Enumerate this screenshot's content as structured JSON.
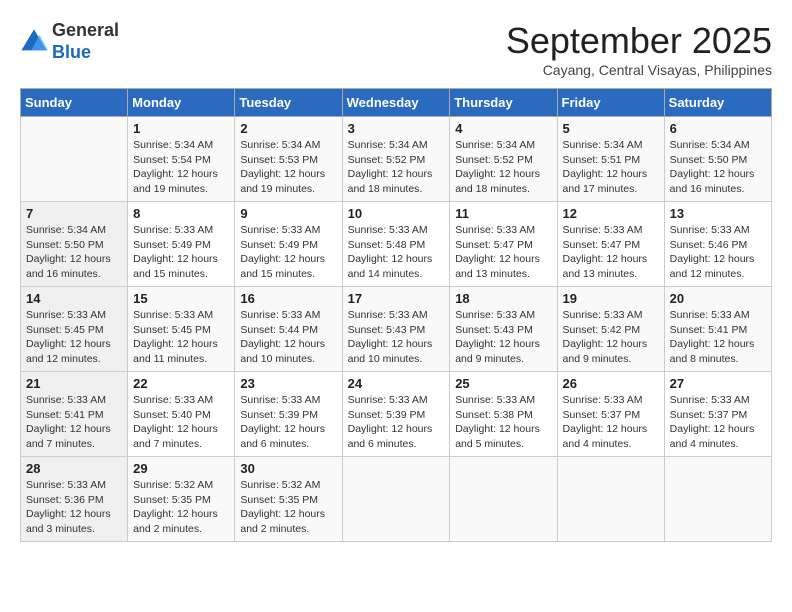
{
  "header": {
    "logo_line1": "General",
    "logo_line2": "Blue",
    "month": "September 2025",
    "location": "Cayang, Central Visayas, Philippines"
  },
  "days_of_week": [
    "Sunday",
    "Monday",
    "Tuesday",
    "Wednesday",
    "Thursday",
    "Friday",
    "Saturday"
  ],
  "weeks": [
    [
      {
        "day": "",
        "info": ""
      },
      {
        "day": "1",
        "info": "Sunrise: 5:34 AM\nSunset: 5:54 PM\nDaylight: 12 hours\nand 19 minutes."
      },
      {
        "day": "2",
        "info": "Sunrise: 5:34 AM\nSunset: 5:53 PM\nDaylight: 12 hours\nand 19 minutes."
      },
      {
        "day": "3",
        "info": "Sunrise: 5:34 AM\nSunset: 5:52 PM\nDaylight: 12 hours\nand 18 minutes."
      },
      {
        "day": "4",
        "info": "Sunrise: 5:34 AM\nSunset: 5:52 PM\nDaylight: 12 hours\nand 18 minutes."
      },
      {
        "day": "5",
        "info": "Sunrise: 5:34 AM\nSunset: 5:51 PM\nDaylight: 12 hours\nand 17 minutes."
      },
      {
        "day": "6",
        "info": "Sunrise: 5:34 AM\nSunset: 5:50 PM\nDaylight: 12 hours\nand 16 minutes."
      }
    ],
    [
      {
        "day": "7",
        "info": "Sunrise: 5:34 AM\nSunset: 5:50 PM\nDaylight: 12 hours\nand 16 minutes."
      },
      {
        "day": "8",
        "info": "Sunrise: 5:33 AM\nSunset: 5:49 PM\nDaylight: 12 hours\nand 15 minutes."
      },
      {
        "day": "9",
        "info": "Sunrise: 5:33 AM\nSunset: 5:49 PM\nDaylight: 12 hours\nand 15 minutes."
      },
      {
        "day": "10",
        "info": "Sunrise: 5:33 AM\nSunset: 5:48 PM\nDaylight: 12 hours\nand 14 minutes."
      },
      {
        "day": "11",
        "info": "Sunrise: 5:33 AM\nSunset: 5:47 PM\nDaylight: 12 hours\nand 13 minutes."
      },
      {
        "day": "12",
        "info": "Sunrise: 5:33 AM\nSunset: 5:47 PM\nDaylight: 12 hours\nand 13 minutes."
      },
      {
        "day": "13",
        "info": "Sunrise: 5:33 AM\nSunset: 5:46 PM\nDaylight: 12 hours\nand 12 minutes."
      }
    ],
    [
      {
        "day": "14",
        "info": "Sunrise: 5:33 AM\nSunset: 5:45 PM\nDaylight: 12 hours\nand 12 minutes."
      },
      {
        "day": "15",
        "info": "Sunrise: 5:33 AM\nSunset: 5:45 PM\nDaylight: 12 hours\nand 11 minutes."
      },
      {
        "day": "16",
        "info": "Sunrise: 5:33 AM\nSunset: 5:44 PM\nDaylight: 12 hours\nand 10 minutes."
      },
      {
        "day": "17",
        "info": "Sunrise: 5:33 AM\nSunset: 5:43 PM\nDaylight: 12 hours\nand 10 minutes."
      },
      {
        "day": "18",
        "info": "Sunrise: 5:33 AM\nSunset: 5:43 PM\nDaylight: 12 hours\nand 9 minutes."
      },
      {
        "day": "19",
        "info": "Sunrise: 5:33 AM\nSunset: 5:42 PM\nDaylight: 12 hours\nand 9 minutes."
      },
      {
        "day": "20",
        "info": "Sunrise: 5:33 AM\nSunset: 5:41 PM\nDaylight: 12 hours\nand 8 minutes."
      }
    ],
    [
      {
        "day": "21",
        "info": "Sunrise: 5:33 AM\nSunset: 5:41 PM\nDaylight: 12 hours\nand 7 minutes."
      },
      {
        "day": "22",
        "info": "Sunrise: 5:33 AM\nSunset: 5:40 PM\nDaylight: 12 hours\nand 7 minutes."
      },
      {
        "day": "23",
        "info": "Sunrise: 5:33 AM\nSunset: 5:39 PM\nDaylight: 12 hours\nand 6 minutes."
      },
      {
        "day": "24",
        "info": "Sunrise: 5:33 AM\nSunset: 5:39 PM\nDaylight: 12 hours\nand 6 minutes."
      },
      {
        "day": "25",
        "info": "Sunrise: 5:33 AM\nSunset: 5:38 PM\nDaylight: 12 hours\nand 5 minutes."
      },
      {
        "day": "26",
        "info": "Sunrise: 5:33 AM\nSunset: 5:37 PM\nDaylight: 12 hours\nand 4 minutes."
      },
      {
        "day": "27",
        "info": "Sunrise: 5:33 AM\nSunset: 5:37 PM\nDaylight: 12 hours\nand 4 minutes."
      }
    ],
    [
      {
        "day": "28",
        "info": "Sunrise: 5:33 AM\nSunset: 5:36 PM\nDaylight: 12 hours\nand 3 minutes."
      },
      {
        "day": "29",
        "info": "Sunrise: 5:32 AM\nSunset: 5:35 PM\nDaylight: 12 hours\nand 2 minutes."
      },
      {
        "day": "30",
        "info": "Sunrise: 5:32 AM\nSunset: 5:35 PM\nDaylight: 12 hours\nand 2 minutes."
      },
      {
        "day": "",
        "info": ""
      },
      {
        "day": "",
        "info": ""
      },
      {
        "day": "",
        "info": ""
      },
      {
        "day": "",
        "info": ""
      }
    ]
  ]
}
